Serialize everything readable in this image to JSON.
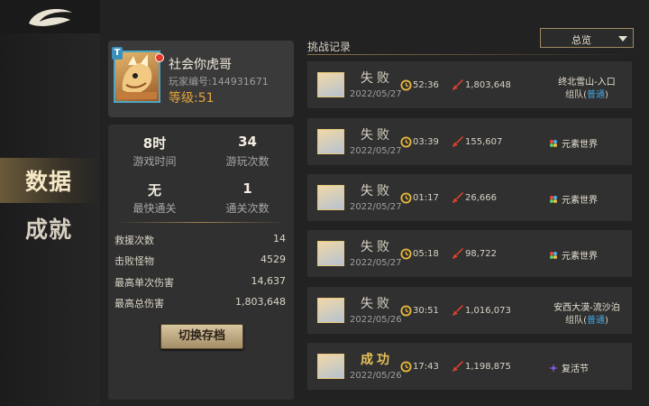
{
  "nav": {
    "data_label": "数据",
    "achievement_label": "成就"
  },
  "profile": {
    "name": "社会你虎哥",
    "player_id": "玩家编号:144931671",
    "level": "等级:51",
    "tag": "T"
  },
  "stats": {
    "play_time": {
      "value": "8时",
      "label": "游戏时间"
    },
    "play_count": {
      "value": "34",
      "label": "游玩次数"
    },
    "fastest": {
      "value": "无",
      "label": "最快通关"
    },
    "clear_count": {
      "value": "1",
      "label": "通关次数"
    },
    "rows": [
      {
        "label": "救援次数",
        "value": "14"
      },
      {
        "label": "击败怪物",
        "value": "4529"
      },
      {
        "label": "最高单次伤害",
        "value": "14,637"
      },
      {
        "label": "最高总伤害",
        "value": "1,803,648"
      }
    ],
    "switch_label": "切换存档"
  },
  "records_title": "挑战记录",
  "dropdown": {
    "selected": "总览"
  },
  "records": [
    {
      "result": "失败",
      "win": false,
      "date": "2022/05/27",
      "time": "52:36",
      "damage": "1,803,648",
      "stage": "终北雪山-入口",
      "team_prefix": "组队(",
      "team_mode": "普通",
      "team_suffix": ")",
      "element": ""
    },
    {
      "result": "失败",
      "win": false,
      "date": "2022/05/27",
      "time": "03:39",
      "damage": "155,607",
      "stage": "",
      "element": "元素世界"
    },
    {
      "result": "失败",
      "win": false,
      "date": "2022/05/27",
      "time": "01:17",
      "damage": "26,666",
      "stage": "",
      "element": "元素世界"
    },
    {
      "result": "失败",
      "win": false,
      "date": "2022/05/27",
      "time": "05:18",
      "damage": "98,722",
      "stage": "",
      "element": "元素世界"
    },
    {
      "result": "失败",
      "win": false,
      "date": "2022/05/26",
      "time": "30:51",
      "damage": "1,016,073",
      "stage": "安西大漠-流沙泊",
      "team_prefix": "组队(",
      "team_mode": "普通",
      "team_suffix": ")",
      "element": ""
    },
    {
      "result": "成功",
      "win": true,
      "date": "2022/05/26",
      "time": "17:43",
      "damage": "1,198,875",
      "stage": "",
      "element": "复活节"
    }
  ]
}
